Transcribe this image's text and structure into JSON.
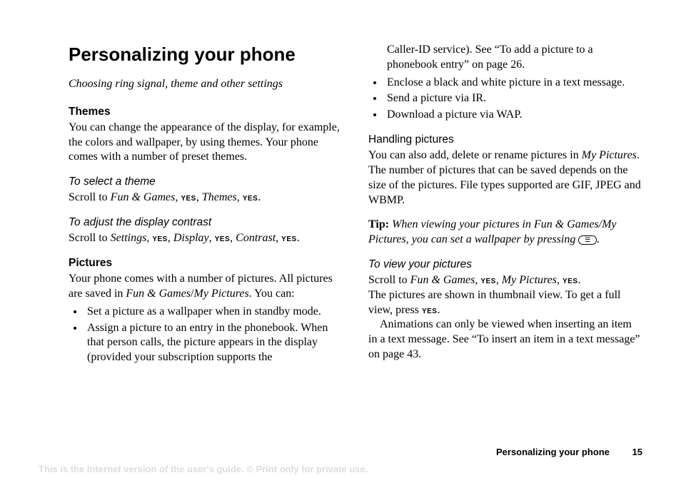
{
  "heading": "Personalizing your phone",
  "subtitle": "Choosing ring signal, theme and other settings",
  "left": {
    "themes_h": "Themes",
    "themes_p": "You can change the appearance of the display, for example, the colors and wallpaper, by using themes. Your phone comes with a number of preset themes.",
    "select_theme_h": "To select a theme",
    "select_theme_pre": "Scroll to ",
    "select_theme_fun": "Fun & Games",
    "select_theme_mid": ", ",
    "select_theme_themes": "Themes",
    "yes": "YES",
    "contrast_h": "To adjust the display contrast",
    "contrast_pre": "Scroll to ",
    "contrast_settings": "Settings",
    "contrast_display": "Display",
    "contrast_contrast": "Contrast",
    "pictures_h": "Pictures",
    "pictures_p1": "Your phone comes with a number of pictures. All pictures are saved in ",
    "pictures_fun": "Fun & Games",
    "pictures_slash": "/",
    "pictures_my": "My Pictures",
    "pictures_p1_end": ". You can:",
    "li1": "Set a picture as a wallpaper when in standby mode.",
    "li2": "Assign a picture to an entry in the phonebook. When that person calls, the picture appears in the display (provided your subscription supports the"
  },
  "right": {
    "cont1": "Caller-ID service). See “To add a picture to a phonebook entry” on page 26.",
    "li3": "Enclose a black and white picture in a text message.",
    "li4": "Send a picture via IR.",
    "li5": "Download a picture via WAP.",
    "handling_h": "Handling pictures",
    "handling_p_a": "You can also add, delete or rename pictures in ",
    "handling_my": "My Pictures",
    "handling_p_b": ". The number of pictures that can be saved depends on the size of the pictures. File types supported are GIF, JPEG and WBMP.",
    "tip_bold": "Tip:",
    "tip_it": " When viewing your pictures in Fun & Games/My Pictures, you can set a wallpaper by pressing ",
    "tip_end": ".",
    "view_h": "To view your pictures",
    "view_pre": "Scroll to ",
    "view_fun": "Fun & Games",
    "view_my": "My Pictures",
    "view_p2a": "The pictures are shown in thumbnail view. To get a full view, press ",
    "view_p2b": ".",
    "view_p3": "Animations can only be viewed when inserting an item in a text message. See “To insert an item in a text message” on page 43."
  },
  "footer": {
    "section": "Personalizing your phone",
    "page": "15",
    "watermark": "This is the Internet version of the user's guide. © Print only for private use."
  }
}
